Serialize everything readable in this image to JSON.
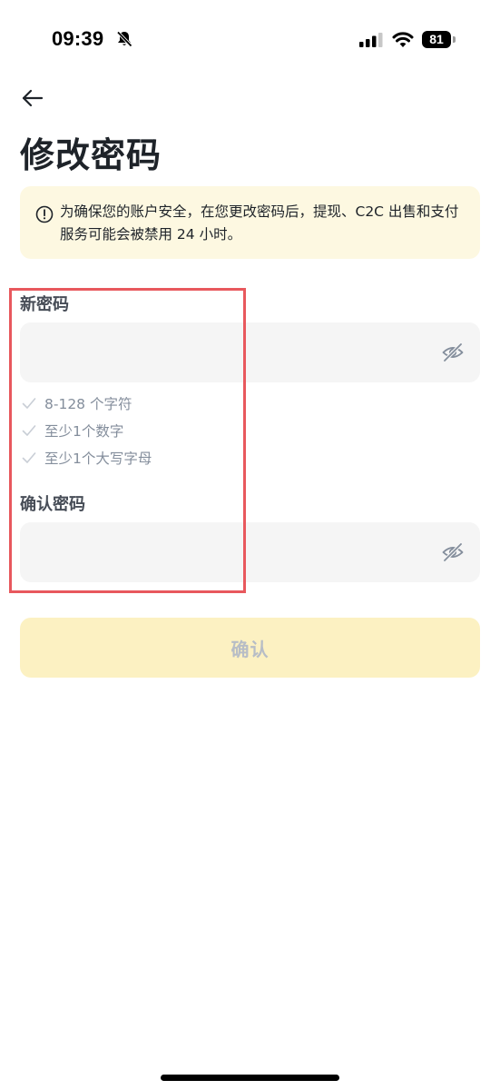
{
  "status_bar": {
    "time": "09:39",
    "battery": "81",
    "icons": [
      "bell-off-icon",
      "signal-icon",
      "wifi-icon",
      "battery-icon"
    ]
  },
  "header": {
    "back_icon": "arrow-left-icon",
    "title": "修改密码"
  },
  "notice": {
    "icon": "info-circle-icon",
    "text": "为确保您的账户安全，在您更改密码后，提现、C2C 出售和支付服务可能会被禁用 24 小时。",
    "background": "#fdf8e1"
  },
  "form": {
    "new_password": {
      "label": "新密码",
      "value": "",
      "toggle_icon": "eye-off-icon"
    },
    "rules": [
      {
        "text": "8-128 个字符",
        "icon": "check-icon"
      },
      {
        "text": "至少1个数字",
        "icon": "check-icon"
      },
      {
        "text": "至少1个大写字母",
        "icon": "check-icon"
      }
    ],
    "confirm_password": {
      "label": "确认密码",
      "value": "",
      "toggle_icon": "eye-off-icon"
    }
  },
  "confirm_button": {
    "label": "确认",
    "background": "#fcf1c2",
    "text_color": "#b7bdc6"
  },
  "annotation": {
    "color": "#e8585d"
  }
}
